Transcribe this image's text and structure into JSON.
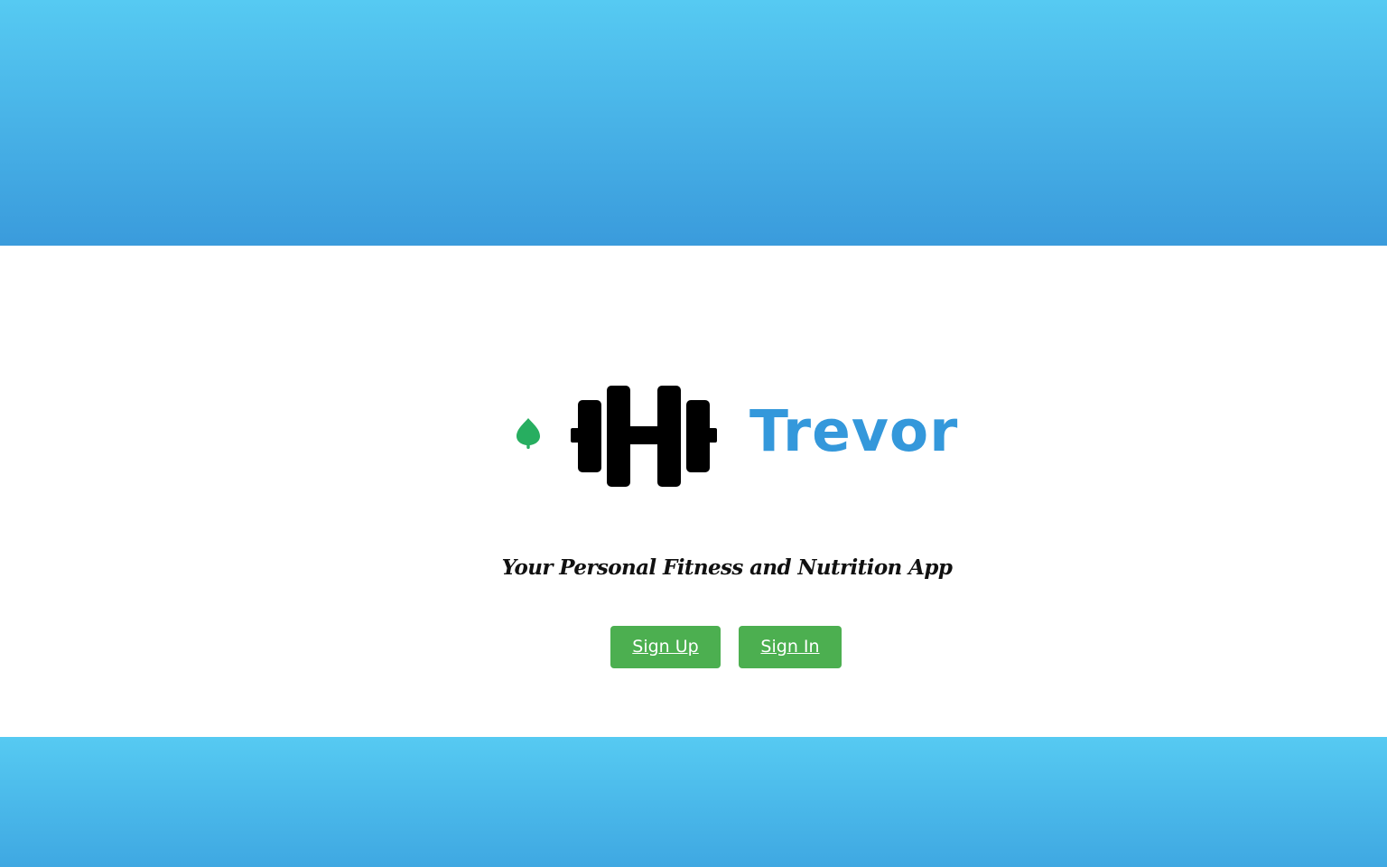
{
  "hero": {
    "brand_name": "Trevor",
    "tagline": "Your Personal Fitness and Nutrition App"
  },
  "actions": {
    "sign_up_label": "Sign Up",
    "sign_in_label": "Sign In"
  },
  "icons": {
    "leaf": "leaf-icon",
    "dumbbell": "dumbbell-icon"
  },
  "colors": {
    "gradient_top": "#56caf2",
    "gradient_bottom": "#3a9bdc",
    "brand_blue": "#3498db",
    "leaf_green": "#27ae60",
    "button_green": "#4caf50",
    "background": "#ffffff"
  }
}
